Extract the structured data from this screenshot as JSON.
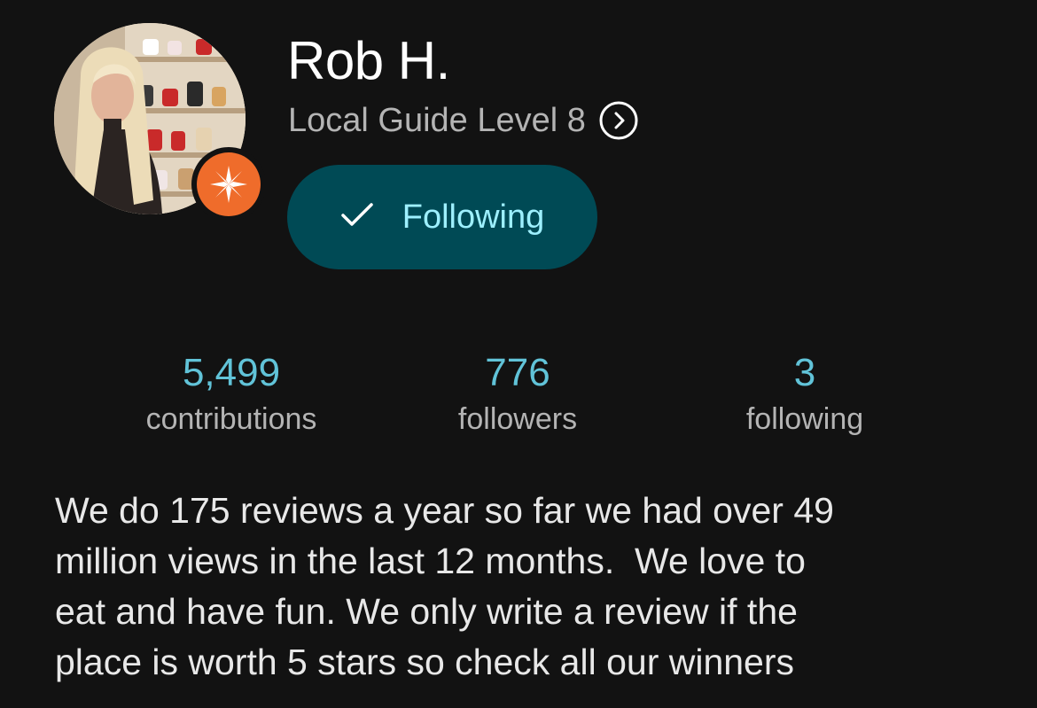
{
  "profile": {
    "name": "Rob H.",
    "level": "Local Guide Level 8",
    "follow_button": "Following"
  },
  "stats": [
    {
      "value": "5,499",
      "label": "contributions"
    },
    {
      "value": "776",
      "label": "followers"
    },
    {
      "value": "3",
      "label": "following"
    }
  ],
  "bio": "We do 175 reviews a year so far we had over 49\nmillion views in the last 12 months.  We love to\neat and have fun. We only write a review if the\nplace is worth 5 stars so check all our winners",
  "icons": {
    "badge": "local-guide-badge-icon",
    "level_chevron": "chevron-right-circle-icon",
    "follow_check": "check-icon"
  },
  "colors": {
    "background": "#121212",
    "button_bg": "#004a55",
    "button_text": "#9ef0ff",
    "stat_value": "#61c3d8",
    "secondary_text": "#b4b4b4",
    "badge": "#ef6c2b"
  }
}
